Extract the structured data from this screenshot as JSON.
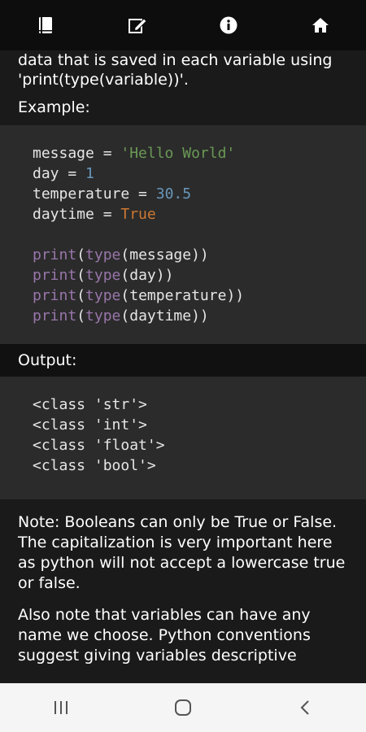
{
  "toolbar": {
    "icons": [
      "book-icon",
      "edit-icon",
      "info-icon",
      "home-icon"
    ]
  },
  "intro": {
    "line1": "data that is saved in each variable using",
    "line2": "'print(type(variable))'."
  },
  "example_label": "Example:",
  "code": {
    "l1": {
      "name": "message",
      "op": " = ",
      "val": "'Hello World'"
    },
    "l2": {
      "name": "day",
      "op": " = ",
      "val": "1"
    },
    "l3": {
      "name": "temperature",
      "op": " = ",
      "val": "30.5"
    },
    "l4": {
      "name": "daytime",
      "op": " = ",
      "val": "True"
    },
    "p1": {
      "f1": "print",
      "o1": "(",
      "f2": "type",
      "o2": "(",
      "arg": "message",
      "close": "))"
    },
    "p2": {
      "f1": "print",
      "o1": "(",
      "f2": "type",
      "o2": "(",
      "arg": "day",
      "close": "))"
    },
    "p3": {
      "f1": "print",
      "o1": "(",
      "f2": "type",
      "o2": "(",
      "arg": "temperature",
      "close": "))"
    },
    "p4": {
      "f1": "print",
      "o1": "(",
      "f2": "type",
      "o2": "(",
      "arg": "daytime",
      "close": "))"
    }
  },
  "output_label": "Output:",
  "output": [
    "<class 'str'>",
    "<class 'int'>",
    "<class 'float'>",
    "<class 'bool'>"
  ],
  "note": {
    "p1": "Note: Booleans can only be True or False. The capitalization is very important here as python will not accept a lowercase true or false.",
    "p2": "Also note that variables can have any name we choose. Python conventions suggest giving variables descriptive"
  },
  "colors": {
    "string": "#6a9955",
    "number": "#6897bb",
    "boolean": "#cc7832",
    "function": "#9876aa",
    "code_bg": "#2b2b2b",
    "toolbar_bg": "#0d0d0d"
  }
}
